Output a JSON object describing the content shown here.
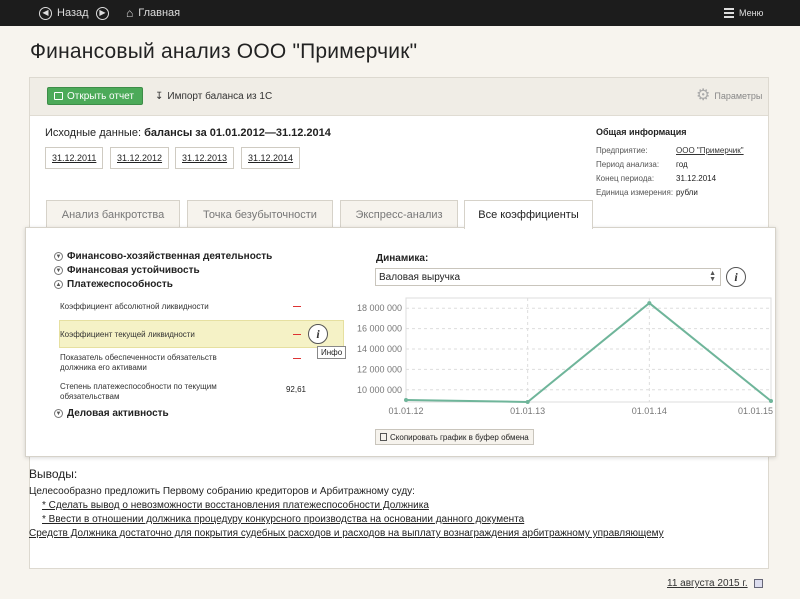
{
  "topbar": {
    "back_label": "Назад",
    "home_label": "Главная",
    "menu_label": "Меню"
  },
  "page_title": "Финансовый анализ ООО \"Примерчик\"",
  "toolbar": {
    "report_label": "Открыть отчет",
    "import_label": "Импорт баланса из 1С",
    "params_label": "Параметры"
  },
  "source": {
    "prefix": "Исходные данные:",
    "value": "балансы за 01.01.2012—31.12.2014"
  },
  "dates": [
    "31.12.2011",
    "31.12.2012",
    "31.12.2013",
    "31.12.2014"
  ],
  "general": {
    "title": "Общая информация",
    "rows": [
      {
        "k": "Предприятие:",
        "v": "ООО \"Примерчик\""
      },
      {
        "k": "Период анализа:",
        "v": "год"
      },
      {
        "k": "Конец периода:",
        "v": "31.12.2014"
      },
      {
        "k": "Единица измерения:",
        "v": "рубли"
      }
    ]
  },
  "tabs": [
    "Анализ банкротства",
    "Точка безубыточности",
    "Экспресс-анализ",
    "Все коэффициенты"
  ],
  "sections": {
    "s1": "Финансово-хозяйственная деятельность",
    "s2": "Финансовая устойчивость",
    "s3": "Платежеспособность",
    "s4": "Деловая активность"
  },
  "coefs": [
    {
      "label": "Коэффициент абсолютной ликвидности",
      "value": ""
    },
    {
      "label": "Коэффициент текущей ликвидности",
      "value": ""
    },
    {
      "label": "Показатель обеспеченности обязательств должника его активами",
      "value": ""
    },
    {
      "label": "Степень платежеспособности по текущим обязательствам",
      "value": "92,61"
    }
  ],
  "tooltip": "Инфо",
  "dynamics": {
    "label": "Динамика:",
    "selected": "Валовая выручка",
    "copy_label": "Скопировать график в буфер обмена"
  },
  "chart_data": {
    "type": "line",
    "x": [
      "01.01.12",
      "01.01.13",
      "01.01.14",
      "01.01.15"
    ],
    "values": [
      9000000,
      8800000,
      18500000,
      8900000
    ],
    "yticks": [
      "10 000 000",
      "12 000 000",
      "14 000 000",
      "16 000 000",
      "18 000 000"
    ],
    "ylim": [
      8800000,
      19000000
    ],
    "grid": true,
    "color": "#6fb59a"
  },
  "conclusions": {
    "title": "Выводы:",
    "intro": "Целесообразно предложить Первому собранию кредиторов и Арбитражному суду:",
    "items": [
      "* Сделать вывод о невозможности восстановления платежеспособности Должника",
      "* Ввести в отношении должника процедуру конкурсного производства на основании данного документа"
    ],
    "note": "Средств Должника достаточно для покрытия судебных расходов и расходов на выплату вознаграждения арбитражному управляющему"
  },
  "footer": {
    "date": "11 августа 2015 г."
  }
}
